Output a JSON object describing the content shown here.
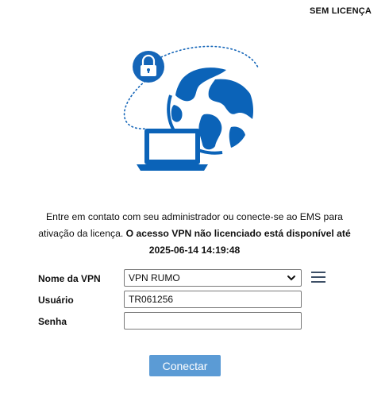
{
  "header": {
    "license_status": "SEM LICENÇA"
  },
  "message": {
    "line1": "Entre em contato com seu administrador ou conecte-se ao EMS para",
    "line2_normal": "ativação da licença.",
    "line2_bold": "O acesso VPN não licenciado está disponível até",
    "expiry_datetime": "2025-06-14 14:19:48"
  },
  "form": {
    "vpn_label": "Nome da VPN",
    "vpn_selected": "VPN RUMO",
    "user_label": "Usuário",
    "user_value": "TR061256",
    "password_label": "Senha",
    "password_value": ""
  },
  "actions": {
    "connect_label": "Conectar"
  },
  "icons": [
    "lock-icon",
    "globe-icon",
    "laptop-icon",
    "chevron-down-icon",
    "menu-icon"
  ],
  "colors": {
    "brand_blue": "#0b63b8",
    "button_blue": "#5b9bd5"
  }
}
